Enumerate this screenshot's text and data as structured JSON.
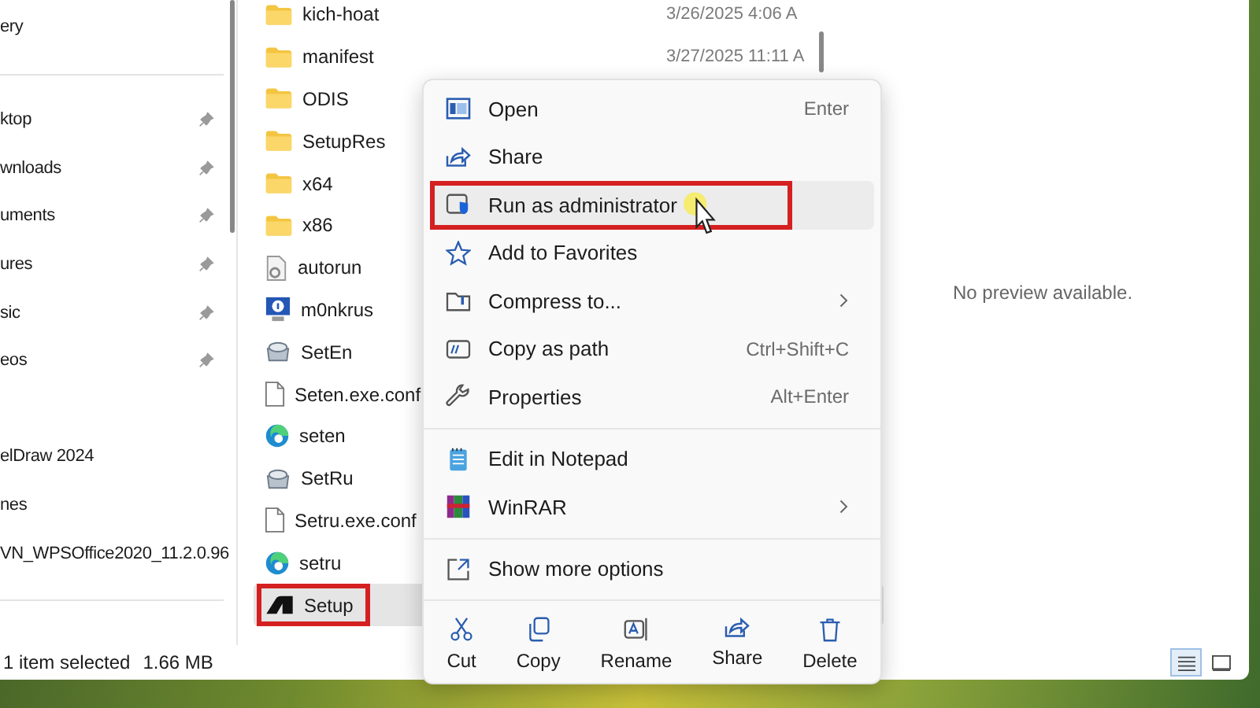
{
  "sidebar": {
    "groups": [
      {
        "divider_after": true,
        "items": [
          {
            "label": "ery",
            "pinned": false
          }
        ]
      },
      {
        "divider_after": false,
        "items": [
          {
            "label": "ktop",
            "pinned": true
          },
          {
            "label": "wnloads",
            "pinned": true
          },
          {
            "label": "uments",
            "pinned": true
          },
          {
            "label": "ures",
            "pinned": true
          },
          {
            "label": "sic",
            "pinned": true
          },
          {
            "label": "eos",
            "pinned": true
          }
        ]
      },
      {
        "divider_after": true,
        "items": [
          {
            "label": "elDraw 2024",
            "pinned": false
          },
          {
            "label": "nes",
            "pinned": false
          },
          {
            "label": "VN_WPSOffice2020_11.2.0.96",
            "pinned": false
          }
        ]
      }
    ]
  },
  "files": [
    {
      "name": "kich-hoat",
      "kind": "folder",
      "date": "3/26/2025 4:06 A",
      "selected": false,
      "marked": false
    },
    {
      "name": "manifest",
      "kind": "folder",
      "date": "3/27/2025 11:11 A",
      "selected": false,
      "marked": false
    },
    {
      "name": "ODIS",
      "kind": "folder",
      "selected": false,
      "marked": false
    },
    {
      "name": "SetupRes",
      "kind": "folder",
      "selected": false,
      "marked": false
    },
    {
      "name": "x64",
      "kind": "folder",
      "selected": false,
      "marked": false
    },
    {
      "name": "x86",
      "kind": "folder",
      "selected": false,
      "marked": false
    },
    {
      "name": "autorun",
      "kind": "settings",
      "selected": false,
      "marked": false
    },
    {
      "name": "m0nkrus",
      "kind": "info",
      "selected": false,
      "marked": false
    },
    {
      "name": "SetEn",
      "kind": "installer",
      "selected": false,
      "marked": false
    },
    {
      "name": "Seten.exe.conf",
      "kind": "document",
      "selected": false,
      "marked": false
    },
    {
      "name": "seten",
      "kind": "browser",
      "selected": false,
      "marked": false
    },
    {
      "name": "SetRu",
      "kind": "installer",
      "selected": false,
      "marked": false
    },
    {
      "name": "Setru.exe.conf",
      "kind": "document",
      "selected": false,
      "marked": false
    },
    {
      "name": "setru",
      "kind": "browser",
      "selected": false,
      "marked": false
    },
    {
      "name": "Setup",
      "kind": "setup",
      "selected": true,
      "marked": true
    }
  ],
  "preview": {
    "message": "No preview available."
  },
  "status_bar": {
    "selection": "1 item selected",
    "size": "1.66 MB"
  },
  "view_buttons": [
    {
      "kind": "details",
      "selected": true
    },
    {
      "kind": "tiles",
      "selected": false
    }
  ],
  "context_menu": {
    "groups": [
      [
        {
          "label": "Open",
          "shortcut": "Enter",
          "submenu": false,
          "hovered": false,
          "marked": false
        },
        {
          "label": "Share",
          "submenu": false,
          "hovered": false,
          "marked": false
        },
        {
          "label": "Run as administrator",
          "submenu": false,
          "hovered": true,
          "marked": true
        },
        {
          "label": "Add to Favorites",
          "submenu": false,
          "hovered": false,
          "marked": false
        },
        {
          "label": "Compress to...",
          "submenu": true,
          "hovered": false,
          "marked": false
        },
        {
          "label": "Copy as path",
          "shortcut": "Ctrl+Shift+C",
          "submenu": false,
          "hovered": false,
          "marked": false
        },
        {
          "label": "Properties",
          "shortcut": "Alt+Enter",
          "submenu": false,
          "hovered": false,
          "marked": false
        }
      ],
      [
        {
          "label": "Edit in Notepad",
          "submenu": false,
          "hovered": false,
          "marked": false
        },
        {
          "label": "WinRAR",
          "submenu": true,
          "hovered": false,
          "marked": false
        }
      ],
      [
        {
          "label": "Show more options",
          "submenu": false,
          "hovered": false,
          "marked": false
        }
      ]
    ],
    "actions": [
      {
        "label": "Cut"
      },
      {
        "label": "Copy"
      },
      {
        "label": "Rename"
      },
      {
        "label": "Share"
      },
      {
        "label": "Delete"
      }
    ]
  }
}
